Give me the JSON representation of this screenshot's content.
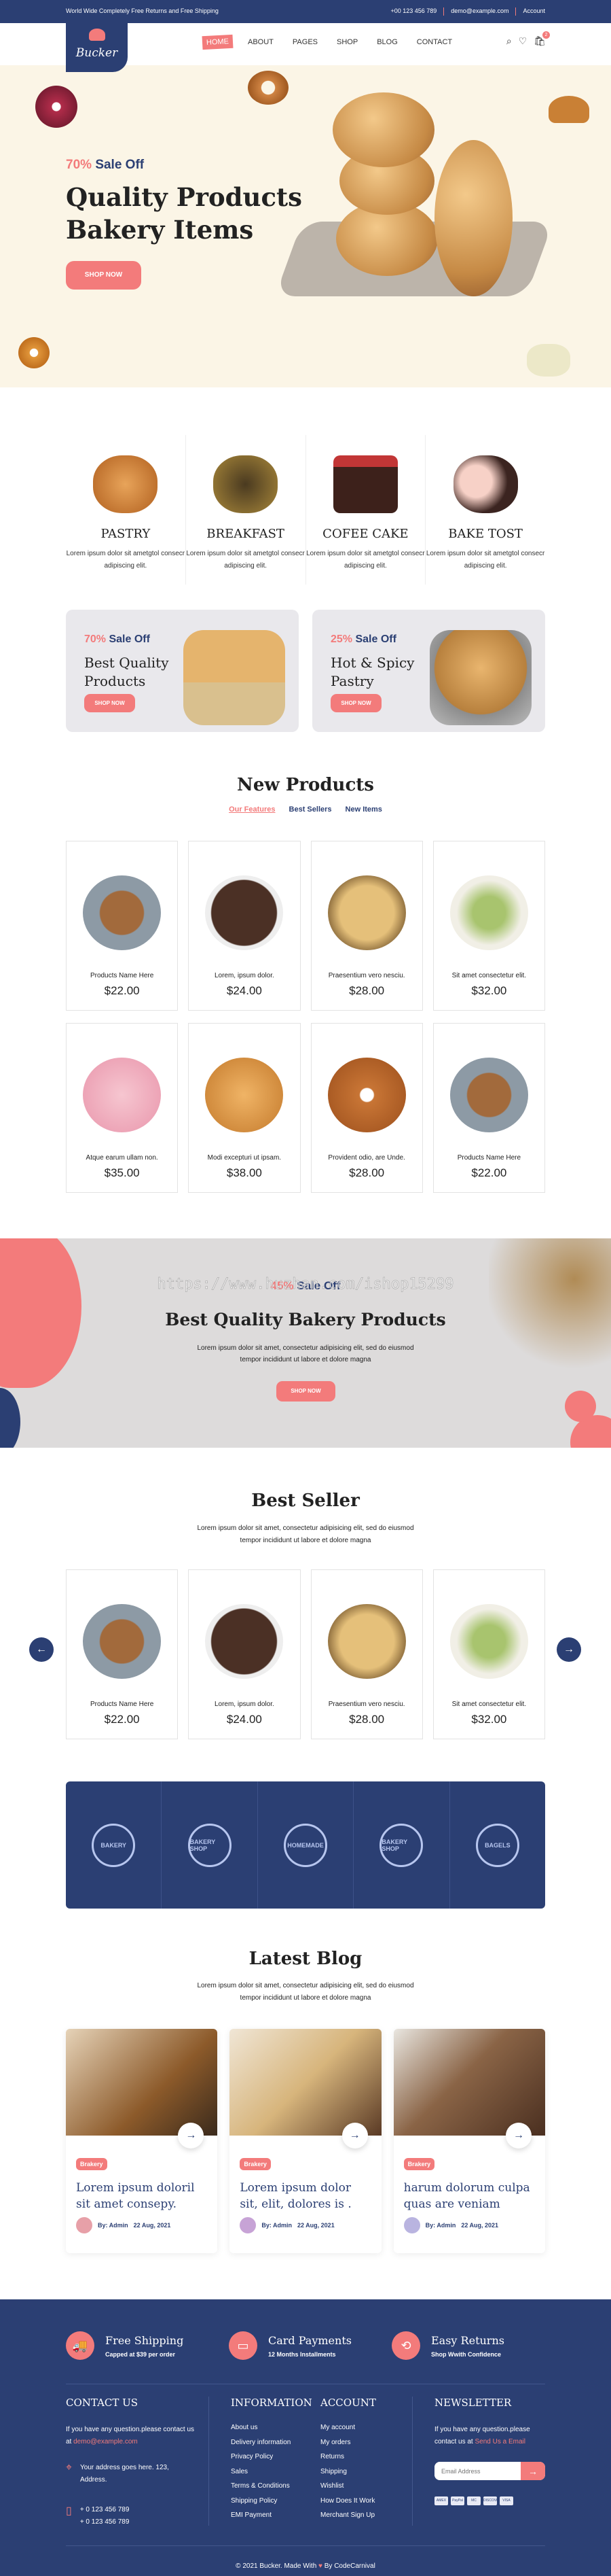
{
  "topbar": {
    "promo": "World Wide Completely Free Returns and Free Shipping",
    "phone": "+00 123 456 789",
    "email": "demo@example.com",
    "account": "Account"
  },
  "brand": {
    "name": "Bucker"
  },
  "nav": {
    "items": [
      "HOME",
      "ABOUT",
      "PAGES",
      "SHOP",
      "BLOG",
      "CONTACT"
    ],
    "active": "HOME",
    "cart_count": "2"
  },
  "colors": {
    "navy": "#2b3f73",
    "accent": "#f37b7b",
    "hero_bg": "#fbf5e6"
  },
  "hero": {
    "percent": "70%",
    "sale": "Sale Off",
    "title_line1": "Quality Products",
    "title_line2": "Bakery Items",
    "button": "SHOP NOW"
  },
  "categories": [
    {
      "title": "PASTRY",
      "desc": "Lorem ipsum dolor sit ametgtol consecr adipiscing elit."
    },
    {
      "title": "BREAKFAST",
      "desc": "Lorem ipsum dolor sit ametgtol consecr adipiscing elit."
    },
    {
      "title": "COFEE CAKE",
      "desc": "Lorem ipsum dolor sit ametgtol consecr adipiscing elit."
    },
    {
      "title": "BAKE TOST",
      "desc": "Lorem ipsum dolor sit ametgtol consecr adipiscing elit."
    }
  ],
  "banners": [
    {
      "percent": "70%",
      "sale": "Sale Off",
      "title_line1": "Best Quality",
      "title_line2": "Products",
      "button": "SHOP NOW"
    },
    {
      "percent": "25%",
      "sale": "Sale Off",
      "title_line1": "Hot & Spicy",
      "title_line2": "Pastry",
      "button": "SHOP NOW"
    }
  ],
  "new_products": {
    "title": "New Products",
    "tabs": [
      "Our Features",
      "Best Sellers",
      "New Items"
    ],
    "items": [
      {
        "name": "Products Name Here",
        "price": "$22.00"
      },
      {
        "name": "Lorem, ipsum dolor.",
        "price": "$24.00"
      },
      {
        "name": "Praesentium vero nesciu.",
        "price": "$28.00"
      },
      {
        "name": "Sit amet consectetur elit.",
        "price": "$32.00"
      },
      {
        "name": "Atque earum ullam non.",
        "price": "$35.00"
      },
      {
        "name": "Modi excepturi ut ipsam.",
        "price": "$38.00"
      },
      {
        "name": "Provident odio, are Unde.",
        "price": "$28.00"
      },
      {
        "name": "Products Name Here",
        "price": "$22.00"
      }
    ]
  },
  "promo": {
    "percent": "45%",
    "sale": "Sale Off",
    "title": "Best Quality Bakery Products",
    "text_line1": "Lorem ipsum dolor sit amet, consectetur adipisicing elit, sed do eiusmod",
    "text_line2": "tempor incididunt ut labore et dolore magna",
    "button": "SHOP NOW",
    "watermark": "https://www.huzhan.com/ishop15299"
  },
  "best_seller": {
    "title": "Best Seller",
    "text_line1": "Lorem ipsum dolor sit amet, consectetur adipisicing elit, sed do eiusmod",
    "text_line2": "tempor incididunt ut labore et dolore magna",
    "items": [
      {
        "name": "Products Name Here",
        "price": "$22.00"
      },
      {
        "name": "Lorem, ipsum dolor.",
        "price": "$24.00"
      },
      {
        "name": "Praesentium vero nesciu.",
        "price": "$28.00"
      },
      {
        "name": "Sit amet consectetur elit.",
        "price": "$32.00"
      }
    ]
  },
  "brands": [
    "BAKERY",
    "BAKERY SHOP",
    "HOMEMADE",
    "BAKERY SHOP",
    "BAGELS"
  ],
  "blog": {
    "title": "Latest Blog",
    "text_line1": "Lorem ipsum dolor sit amet, consectetur adipisicing elit, sed do eiusmod",
    "text_line2": "tempor incididunt ut labore et dolore magna",
    "posts": [
      {
        "tag": "Brakery",
        "title": "Lorem ipsum doloril sit amet consepy.",
        "author": "By: Admin",
        "date": "22 Aug, 2021"
      },
      {
        "tag": "Brakery",
        "title": "Lorem ipsum dolor sit, elit, dolores is .",
        "author": "By: Admin",
        "date": "22 Aug, 2021"
      },
      {
        "tag": "Brakery",
        "title": "harum dolorum culpa quas are veniam",
        "author": "By: Admin",
        "date": "22 Aug, 2021"
      }
    ]
  },
  "footer": {
    "features": [
      {
        "title": "Free Shipping",
        "sub": "Capped at $39 per order"
      },
      {
        "title": "Card Payments",
        "sub": "12 Months Installments"
      },
      {
        "title": "Easy Returns",
        "sub": "Shop Wwith Confidence"
      }
    ],
    "contact": {
      "title": "CONTACT US",
      "text": "If you have any question.please contact us at",
      "email": "demo@example.com",
      "address": "Your address goes here. 123, Address.",
      "phone1": "+ 0 123 456 789",
      "phone2": "+ 0 123 456 789"
    },
    "information": {
      "title": "INFORMATION",
      "links": [
        "About us",
        "Delivery information",
        "Privacy Policy",
        "Sales",
        "Terms & Conditions",
        "Shipping Policy",
        "EMI Payment"
      ]
    },
    "account": {
      "title": "ACCOUNT",
      "links": [
        "My account",
        "My orders",
        "Returns",
        "Shipping",
        "Wishlist",
        "How Does It Work",
        "Merchant Sign Up"
      ]
    },
    "newsletter": {
      "title": "NEWSLETTER",
      "text": "If you have any question.please contact us at",
      "link": "Send Us a Email",
      "placeholder": "Email Address"
    },
    "payments": [
      "AMEX",
      "PayPal",
      "MC",
      "DISCOVER",
      "VISA"
    ],
    "copyright_pre": "© 2021 Bucker. Made With",
    "copyright_post": "By CodeCarnival"
  }
}
